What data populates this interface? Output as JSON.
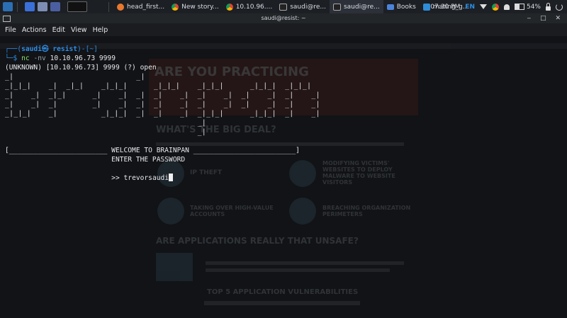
{
  "panel": {
    "tasks": [
      {
        "label": "head_first...",
        "icon": "firefox-icon"
      },
      {
        "label": "New story...",
        "icon": "chrome-icon"
      },
      {
        "label": "10.10.96....",
        "icon": "chrome-icon"
      },
      {
        "label": "saudi@re...",
        "icon": "terminal-icon"
      },
      {
        "label": "saudi@re...",
        "icon": "terminal-icon"
      },
      {
        "label": "Books",
        "icon": "folder-icon"
      },
      {
        "label": "mating_g...",
        "icon": "vscode-icon"
      }
    ],
    "clock": "07:30 PM",
    "lang": "EN",
    "battery": "54%"
  },
  "window": {
    "title": "saudi@resist: ~",
    "menu": [
      "File",
      "Actions",
      "Edit",
      "View",
      "Help"
    ]
  },
  "terminal": {
    "prompt_open": "┌──(",
    "user": "saudi",
    "at": "㉿",
    "host": "resist",
    "prompt_mid": ")-[",
    "dir": "~",
    "prompt_close": "]",
    "prompt_line2": "└─$ ",
    "cmd_name": "nc",
    "cmd_flag": "-nv",
    "cmd_args": "10.10.96.73 9999",
    "output_open": "(UNKNOWN) [10.10.96.73] 9999 (?) open",
    "banner": [
      "_|                            _|",
      "_|_|_|    _|  _|_|    _|_|_|      _|_|_|    _|_|_|      _|_|_|  _|_|_|",
      "_|    _|  _|_|      _|    _|  _|  _|    _|  _|    _|  _|    _|  _|    _|",
      "_|    _|  _|        _|    _|  _|  _|    _|  _|    _|  _|    _|  _|    _|",
      "_|_|_|    _|          _|_|_|  _|  _|    _|  _|_|_|      _|_|_|  _|    _|",
      "                                            _|",
      "                                            _|"
    ],
    "welcome": "[________________________ WELCOME TO BRAINPAN _________________________]",
    "enter_password": "                          ENTER THE PASSWORD",
    "input_prompt": "                          >> ",
    "input_value": "trevorsaudi"
  },
  "background_page": {
    "headline1": "ARE YOU PRACTICING",
    "headline2": "WHAT'S THE BIG DEAL?",
    "headline3": "ARE APPLICATIONS REALLY THAT UNSAFE?",
    "headline4": "TOP 5 APPLICATION VULNERABILITIES",
    "item1": "IP THEFT",
    "item2": "MODIFYING VICTIMS' WEBSITES TO DEPLOY MALWARE TO WEBSITE VISITORS",
    "item3": "TAKING OVER HIGH-VALUE ACCOUNTS",
    "item4": "BREACHING ORGANIZATION PERIMETERS"
  }
}
